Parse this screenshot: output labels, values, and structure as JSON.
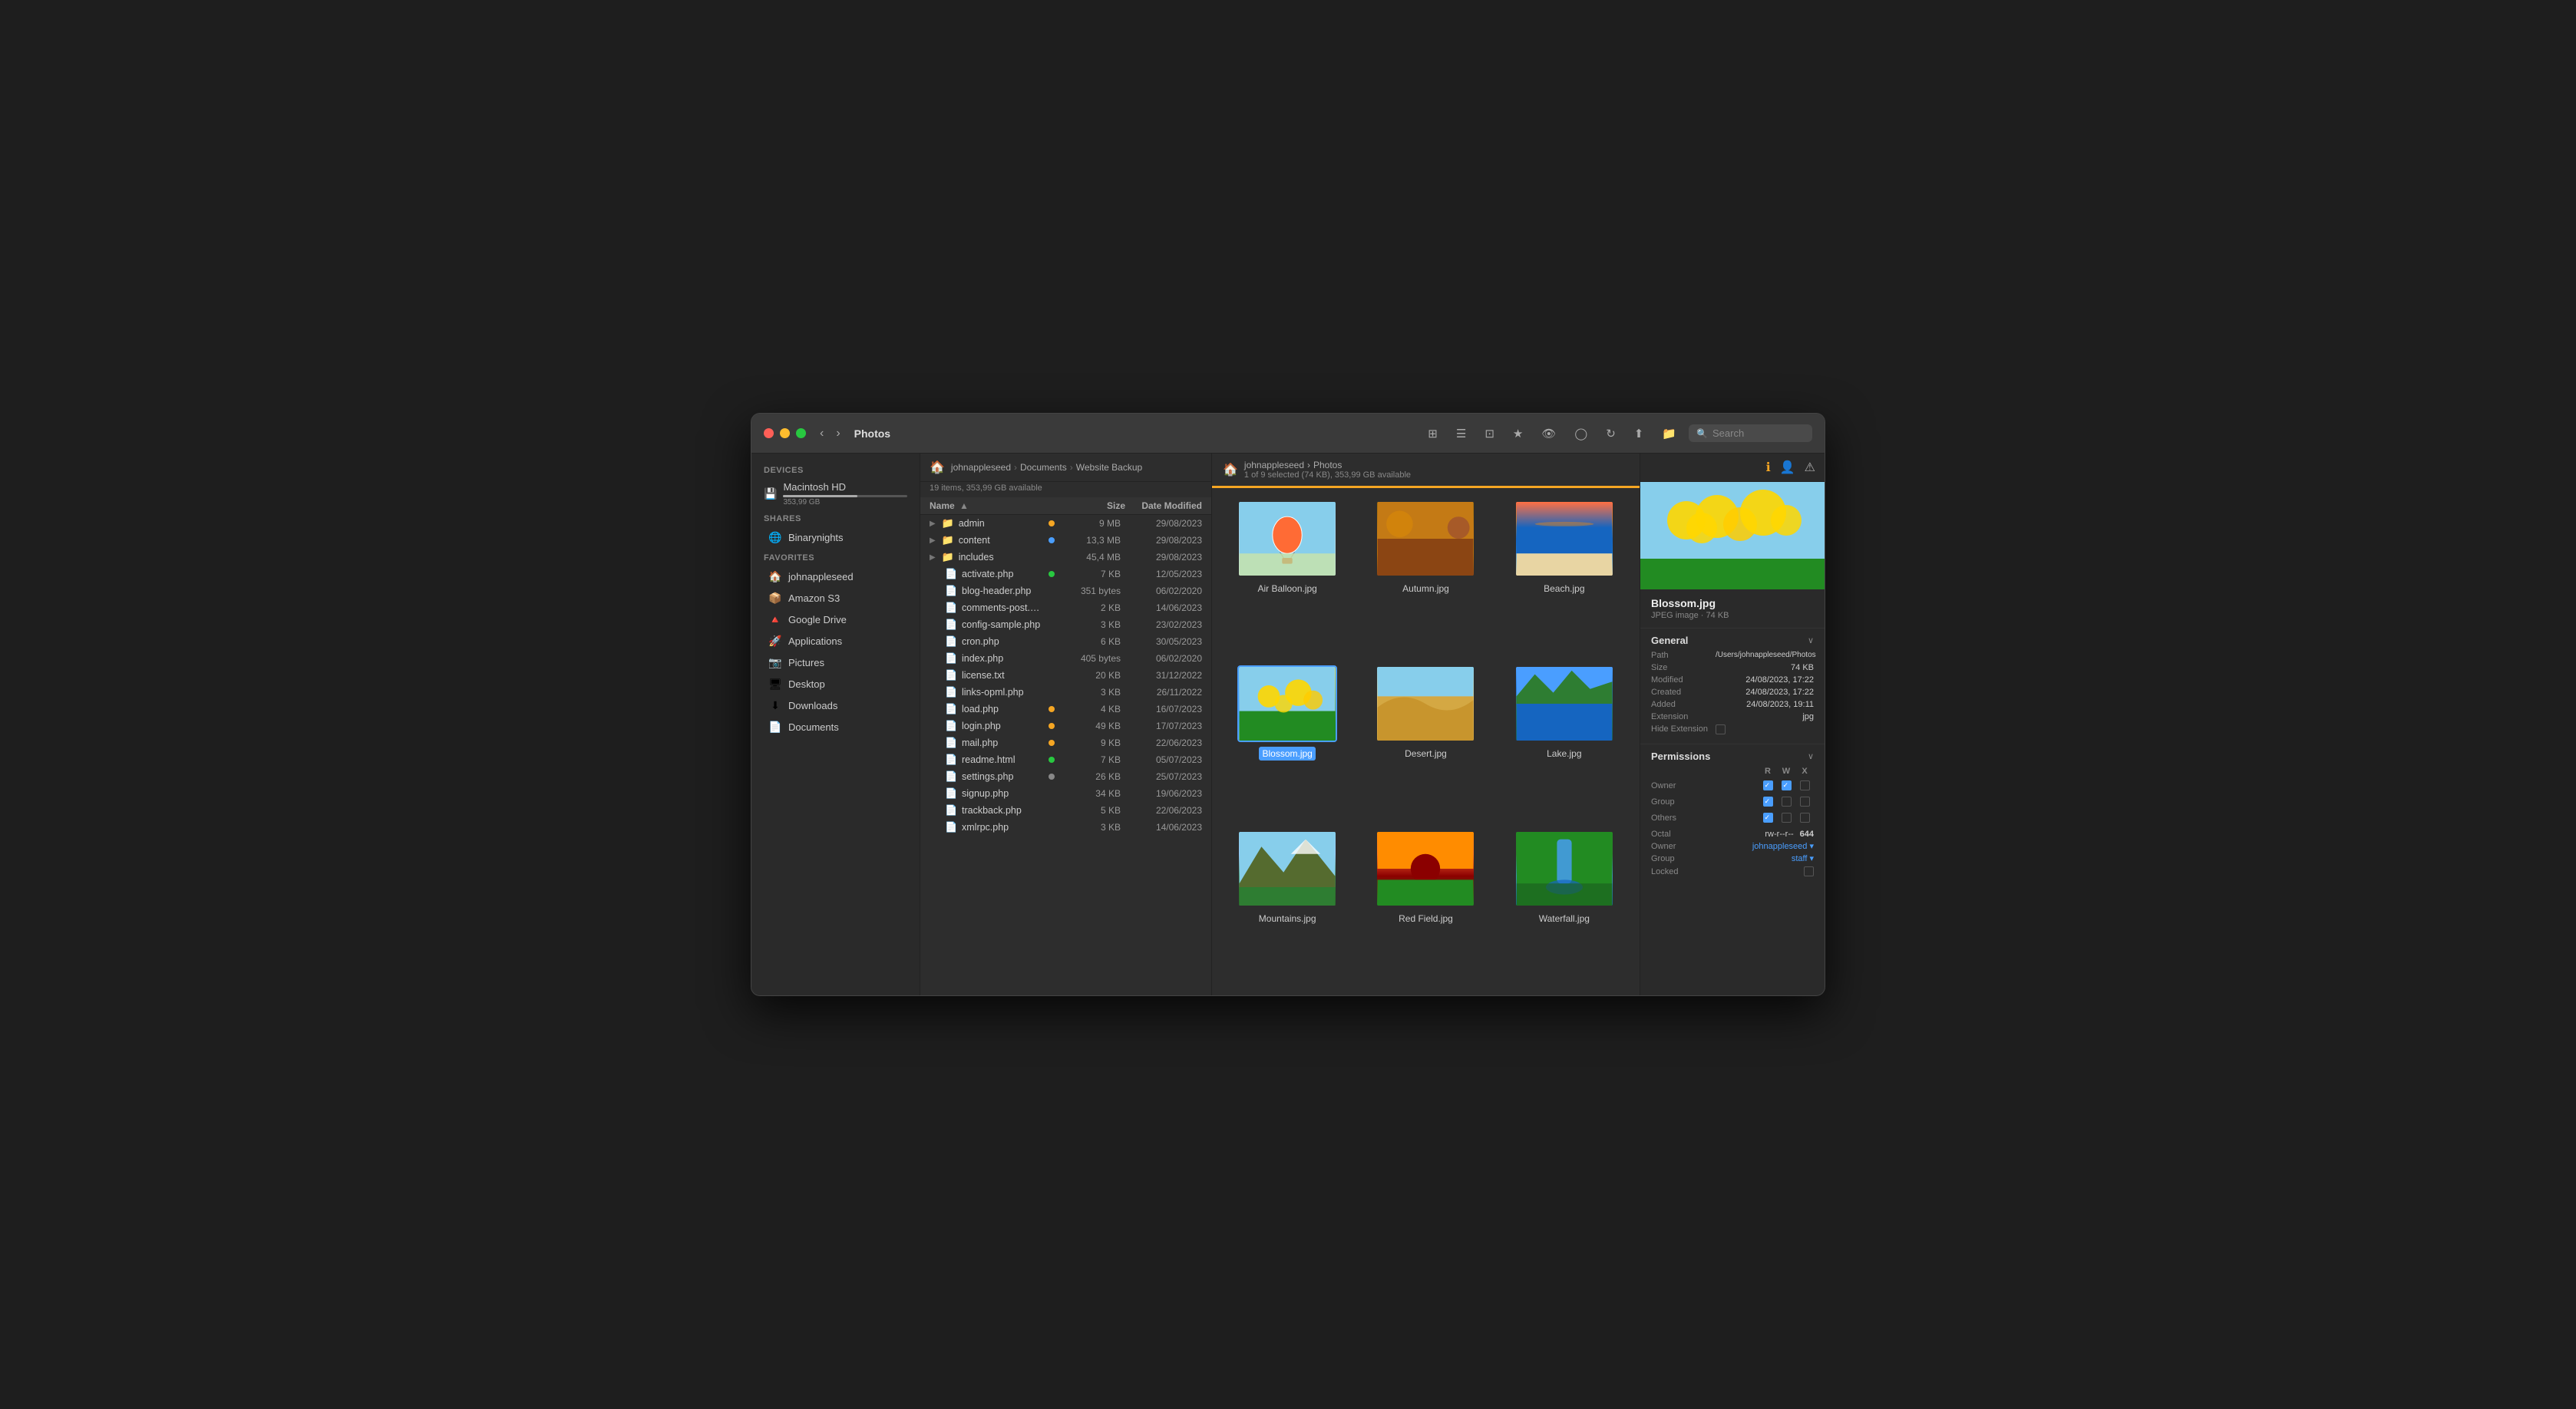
{
  "window": {
    "title": "Photos",
    "traffic_lights": [
      "red",
      "yellow",
      "green"
    ]
  },
  "toolbar": {
    "back_label": "‹",
    "forward_label": "›",
    "title": "Photos",
    "view_icons": [
      "⊞",
      "☰",
      "⊡",
      "★",
      "👁",
      "↻",
      "↑↓",
      "📁"
    ],
    "search_placeholder": "Search",
    "search_label": "Search"
  },
  "sidebar": {
    "devices_label": "Devices",
    "device": {
      "name": "Macintosh HD",
      "size": "353,99 GB"
    },
    "shares_label": "Shares",
    "shares": [
      {
        "label": "Binarynights",
        "icon": "🌐"
      }
    ],
    "favorites_label": "Favorites",
    "favorites": [
      {
        "label": "johnappleseed",
        "icon": "🏠"
      },
      {
        "label": "Amazon S3",
        "icon": "📦"
      },
      {
        "label": "Google Drive",
        "icon": "🔺"
      },
      {
        "label": "Applications",
        "icon": "🚀"
      },
      {
        "label": "Pictures",
        "icon": "📷"
      },
      {
        "label": "Desktop",
        "icon": "🖥"
      },
      {
        "label": "Downloads",
        "icon": "⬇"
      },
      {
        "label": "Documents",
        "icon": "📄"
      }
    ]
  },
  "file_panel": {
    "breadcrumb": [
      "johnappleseed",
      "Documents",
      "Website Backup"
    ],
    "info": "19 items, 353,99 GB available",
    "columns": {
      "name": "Name",
      "size": "Size",
      "date": "Date Modified"
    },
    "files": [
      {
        "name": "admin",
        "type": "folder",
        "dot": "orange",
        "size": "9 MB",
        "date": "29/08/2023"
      },
      {
        "name": "content",
        "type": "folder",
        "dot": "blue",
        "size": "13,3 MB",
        "date": "29/08/2023"
      },
      {
        "name": "includes",
        "type": "folder",
        "dot": "",
        "size": "45,4 MB",
        "date": "29/08/2023"
      },
      {
        "name": "activate.php",
        "type": "file",
        "dot": "green",
        "size": "7 KB",
        "date": "12/05/2023"
      },
      {
        "name": "blog-header.php",
        "type": "file",
        "dot": "",
        "size": "351 bytes",
        "date": "06/02/2020"
      },
      {
        "name": "comments-post.php",
        "type": "file",
        "dot": "",
        "size": "2 KB",
        "date": "14/06/2023"
      },
      {
        "name": "config-sample.php",
        "type": "file",
        "dot": "",
        "size": "3 KB",
        "date": "23/02/2023"
      },
      {
        "name": "cron.php",
        "type": "file",
        "dot": "",
        "size": "6 KB",
        "date": "30/05/2023"
      },
      {
        "name": "index.php",
        "type": "file",
        "dot": "",
        "size": "405 bytes",
        "date": "06/02/2020"
      },
      {
        "name": "license.txt",
        "type": "file",
        "dot": "",
        "size": "20 KB",
        "date": "31/12/2022"
      },
      {
        "name": "links-opml.php",
        "type": "file",
        "dot": "",
        "size": "3 KB",
        "date": "26/11/2022"
      },
      {
        "name": "load.php",
        "type": "file",
        "dot": "orange",
        "size": "4 KB",
        "date": "16/07/2023"
      },
      {
        "name": "login.php",
        "type": "file",
        "dot": "orange",
        "size": "49 KB",
        "date": "17/07/2023"
      },
      {
        "name": "mail.php",
        "type": "file",
        "dot": "orange",
        "size": "9 KB",
        "date": "22/06/2023"
      },
      {
        "name": "readme.html",
        "type": "file",
        "dot": "green",
        "size": "7 KB",
        "date": "05/07/2023"
      },
      {
        "name": "settings.php",
        "type": "file",
        "dot": "gray",
        "size": "26 KB",
        "date": "25/07/2023"
      },
      {
        "name": "signup.php",
        "type": "file",
        "dot": "",
        "size": "34 KB",
        "date": "19/06/2023"
      },
      {
        "name": "trackback.php",
        "type": "file",
        "dot": "",
        "size": "5 KB",
        "date": "22/06/2023"
      },
      {
        "name": "xmlrpc.php",
        "type": "file",
        "dot": "",
        "size": "3 KB",
        "date": "14/06/2023"
      }
    ]
  },
  "photo_panel": {
    "breadcrumb": [
      "johnappleseed",
      "Photos"
    ],
    "info": "1 of 9 selected (74 KB), 353,99 GB available",
    "photos": [
      {
        "name": "Air Balloon.jpg",
        "thumb_class": "thumb-balloon",
        "selected": false
      },
      {
        "name": "Autumn.jpg",
        "thumb_class": "thumb-autumn",
        "selected": false
      },
      {
        "name": "Beach.jpg",
        "thumb_class": "thumb-beach",
        "selected": false
      },
      {
        "name": "Blossom.jpg",
        "thumb_class": "thumb-blossom",
        "selected": true
      },
      {
        "name": "Desert.jpg",
        "thumb_class": "thumb-desert",
        "selected": false
      },
      {
        "name": "Lake.jpg",
        "thumb_class": "thumb-lake",
        "selected": false
      },
      {
        "name": "Mountains.jpg",
        "thumb_class": "thumb-mountains",
        "selected": false
      },
      {
        "name": "Red Field.jpg",
        "thumb_class": "thumb-redfield",
        "selected": false
      },
      {
        "name": "Waterfall.jpg",
        "thumb_class": "thumb-waterfall",
        "selected": false
      }
    ]
  },
  "info_panel": {
    "filename": "Blossom.jpg",
    "filetype": "JPEG image · 74 KB",
    "tabs": [
      "info",
      "user",
      "warning"
    ],
    "general": {
      "title": "General",
      "path": "/Users/johnappleseed/Photos",
      "size": "74 KB",
      "modified": "24/08/2023, 17:22",
      "created": "24/08/2023, 17:22",
      "added": "24/08/2023, 19:11",
      "extension": "jpg",
      "hide_extension_label": "Hide Extension"
    },
    "permissions": {
      "title": "Permissions",
      "col_r": "R",
      "col_w": "W",
      "col_x": "X",
      "rows": [
        {
          "name": "Owner",
          "r": true,
          "w": true,
          "x": false
        },
        {
          "name": "Group",
          "r": true,
          "w": false,
          "x": false
        },
        {
          "name": "Others",
          "r": true,
          "w": false,
          "x": false
        }
      ],
      "octal_label": "Octal",
      "octal_str": "rw-r--r--",
      "octal_num": "644",
      "owner_label": "Owner",
      "owner_val": "johnappleseed",
      "group_label": "Group",
      "group_val": "staff",
      "locked_label": "Locked"
    }
  }
}
